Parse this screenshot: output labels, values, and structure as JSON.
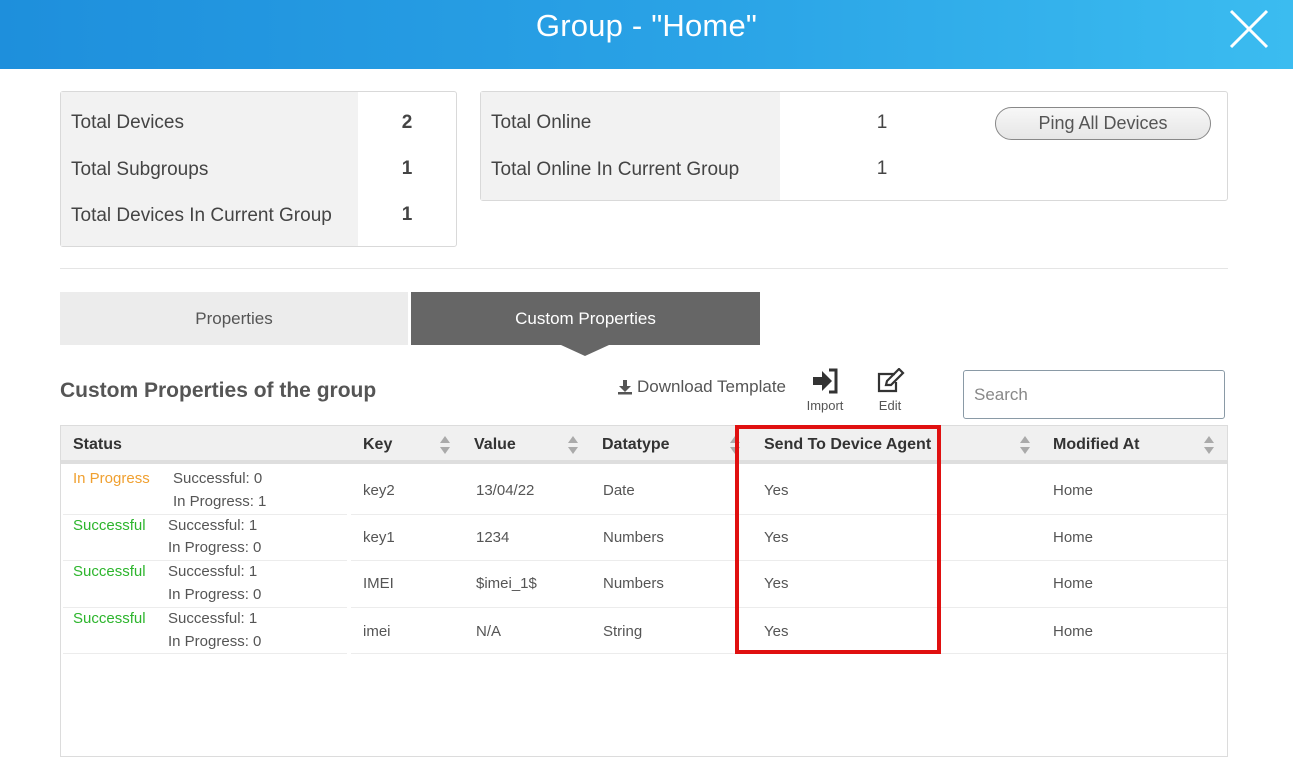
{
  "header": {
    "title": "Group - \"Home\"",
    "close_icon": "close-icon"
  },
  "summary_left": {
    "rows": [
      {
        "label": "Total Devices",
        "value": "2"
      },
      {
        "label": "Total Subgroups",
        "value": "1"
      },
      {
        "label": "Total Devices In Current Group",
        "value": "1"
      }
    ]
  },
  "summary_right": {
    "rows": [
      {
        "label": "Total Online",
        "value": "1"
      },
      {
        "label": "Total Online In Current Group",
        "value": "1"
      }
    ],
    "ping_button": "Ping All Devices"
  },
  "tabs": [
    {
      "label": "Properties",
      "active": false
    },
    {
      "label": "Custom Properties",
      "active": true
    }
  ],
  "section": {
    "title": "Custom Properties of the group",
    "download_label": "Download Template",
    "import_label": "Import",
    "edit_label": "Edit",
    "search_placeholder": "Search"
  },
  "table": {
    "columns": [
      "Status",
      "Key",
      "Value",
      "Datatype",
      "Send To Device Agent",
      "Modified At"
    ],
    "rows": [
      {
        "status": "In Progress",
        "successful": "Successful: 0",
        "in_progress": "In Progress: 1",
        "key": "key2",
        "value": "13/04/22",
        "datatype": "Date",
        "send": "Yes",
        "modified": "Home"
      },
      {
        "status": "Successful",
        "successful": "Successful: 1",
        "in_progress": "In Progress: 0",
        "key": "key1",
        "value": "1234",
        "datatype": "Numbers",
        "send": "Yes",
        "modified": "Home"
      },
      {
        "status": "Successful",
        "successful": "Successful: 1",
        "in_progress": "In Progress: 0",
        "key": "IMEI",
        "value": "$imei_1$",
        "datatype": "Numbers",
        "send": "Yes",
        "modified": "Home"
      },
      {
        "status": "Successful",
        "successful": "Successful: 1",
        "in_progress": "In Progress: 0",
        "key": "imei",
        "value": "N/A",
        "datatype": "String",
        "send": "Yes",
        "modified": "Home"
      }
    ]
  },
  "colors": {
    "header_start": "#1e8fdc",
    "header_end": "#3bbcf0",
    "in_progress": "#f0a030",
    "successful": "#2db52d",
    "highlight": "#e01010",
    "active_tab": "#666666"
  }
}
